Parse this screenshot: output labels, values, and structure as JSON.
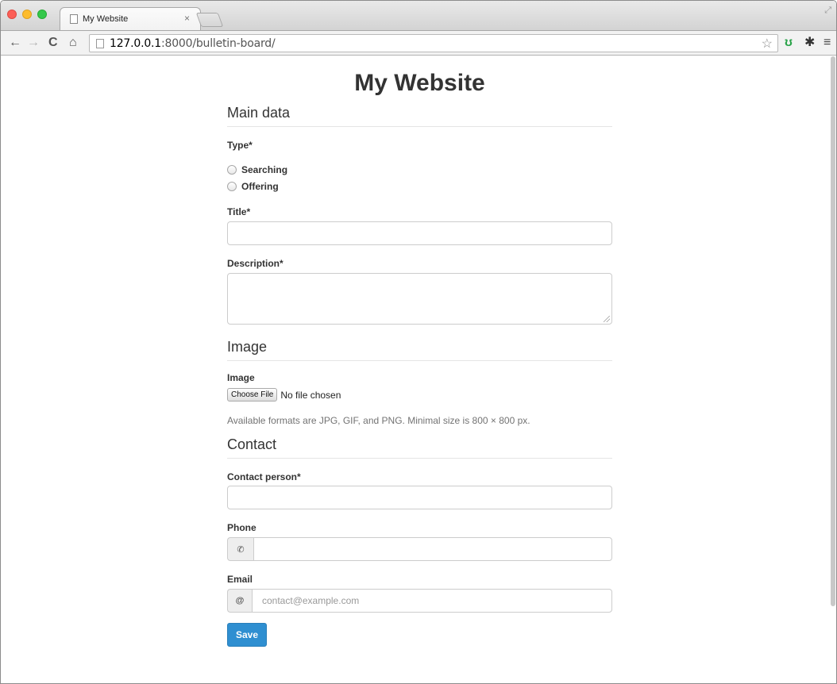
{
  "browser": {
    "tab_title": "My Website",
    "tab_close": "×",
    "url_host": "127.0.0.1",
    "url_path": ":8000/bulletin-board/",
    "nav": {
      "back": "←",
      "forward": "→",
      "reload": "C",
      "home": "⌂"
    },
    "toolbar_icons": {
      "star": "☆",
      "extension": "ʊ",
      "settings": "✱",
      "menu": "≡"
    }
  },
  "page": {
    "site_title": "My Website",
    "sections": {
      "main": "Main data",
      "image": "Image",
      "contact": "Contact"
    },
    "fields": {
      "type_label": "Type*",
      "type_options": [
        "Searching",
        "Offering"
      ],
      "title_label": "Title*",
      "title_value": "",
      "description_label": "Description*",
      "description_value": "",
      "image_label": "Image",
      "choose_file": "Choose File",
      "file_status": "No file chosen",
      "image_help": "Available formats are JPG, GIF, and PNG. Minimal size is 800 × 800 px.",
      "contact_label": "Contact person*",
      "contact_value": "",
      "phone_label": "Phone",
      "phone_value": "",
      "phone_addon": "✆",
      "email_label": "Email",
      "email_addon": "@",
      "email_placeholder": "contact@example.com"
    },
    "save_label": "Save"
  },
  "colors": {
    "primary_button": "#2f8fd1",
    "text": "#333333",
    "help_text": "#737373"
  }
}
